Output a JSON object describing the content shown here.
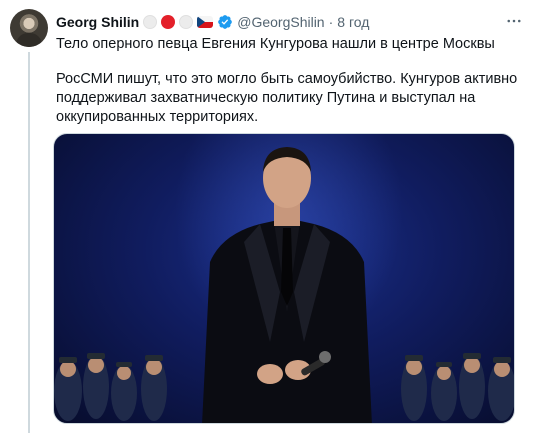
{
  "author": {
    "name": "Georg Shilin",
    "handle": "@GeorgShilin",
    "separator": "·",
    "time": "8 год"
  },
  "icons": {
    "avatar": "avatar-photo",
    "badges": [
      "white-circle-emoji",
      "red-circle-emoji",
      "white-circle-emoji",
      "czech-flag-emoji"
    ],
    "verified": "verified-badge-icon",
    "more": "more-options-icon"
  },
  "tweet": {
    "line1": "Тело оперного певца Евгения Кунгурова нашли в центре Москвы",
    "line2": "РосСМИ пишут, что это могло быть самоубийство. Кунгуров активно",
    "line3": "поддерживал захватническую политику Путина и выступал на",
    "line4": "оккупированных территориях."
  },
  "colors": {
    "verified": "#1d9bf0",
    "secondary_text": "#536471",
    "primary_text": "#0f1419",
    "thread_line": "#cfd9de"
  }
}
